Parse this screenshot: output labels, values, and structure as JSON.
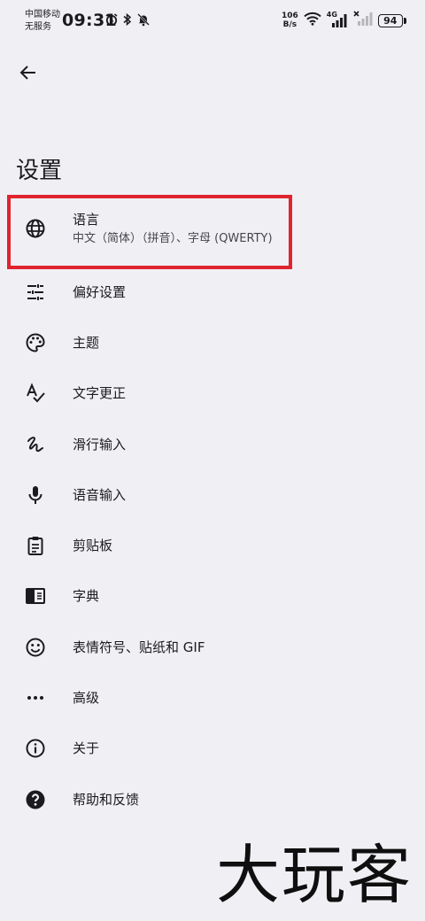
{
  "status_bar": {
    "carrier_line1": "中国移动",
    "carrier_line2": "无服务",
    "time": "09:31",
    "net_speed_value": "106",
    "net_speed_unit": "B/s",
    "network_type": "4G",
    "battery": "94"
  },
  "header": {
    "title": "设置"
  },
  "menu": {
    "items": [
      {
        "label": "语言",
        "sublabel": "中文（简体）（拼音）、字母 (QWERTY)",
        "icon": "globe-icon"
      },
      {
        "label": "偏好设置",
        "icon": "tune-sliders-icon"
      },
      {
        "label": "主题",
        "icon": "palette-icon"
      },
      {
        "label": "文字更正",
        "icon": "spellcheck-icon"
      },
      {
        "label": "滑行输入",
        "icon": "gesture-icon"
      },
      {
        "label": "语音输入",
        "icon": "microphone-icon"
      },
      {
        "label": "剪贴板",
        "icon": "clipboard-icon"
      },
      {
        "label": "字典",
        "icon": "dictionary-book-icon"
      },
      {
        "label": "表情符号、贴纸和 GIF",
        "icon": "emoji-smile-icon"
      },
      {
        "label": "高级",
        "icon": "more-dots-icon"
      },
      {
        "label": "关于",
        "icon": "info-icon"
      },
      {
        "label": "帮助和反馈",
        "icon": "help-icon"
      }
    ]
  },
  "watermark": {
    "text": "大玩客"
  },
  "colors": {
    "background": "#f0f0f4",
    "highlight_border": "#e0242e",
    "text_primary": "#1b1b1f"
  }
}
